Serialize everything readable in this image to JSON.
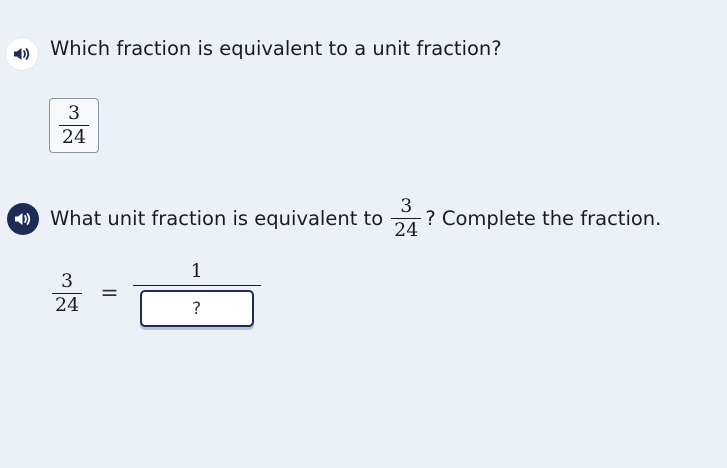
{
  "question1": {
    "prompt": "Which fraction is equivalent to a unit fraction?",
    "given_fraction": {
      "numerator": "3",
      "denominator": "24"
    }
  },
  "question2": {
    "prompt_before": "What unit fraction is equivalent to",
    "inline_fraction": {
      "numerator": "3",
      "denominator": "24"
    },
    "prompt_after": "? Complete the fraction.",
    "equation": {
      "left": {
        "numerator": "3",
        "denominator": "24"
      },
      "equals": "=",
      "right_numerator": "1",
      "right_denominator_placeholder": "?"
    }
  },
  "icons": {
    "speaker_light": "speaker-icon",
    "speaker_dark": "speaker-icon"
  },
  "colors": {
    "background": "#ebf1f7",
    "accent_dark": "#1e2b57"
  }
}
